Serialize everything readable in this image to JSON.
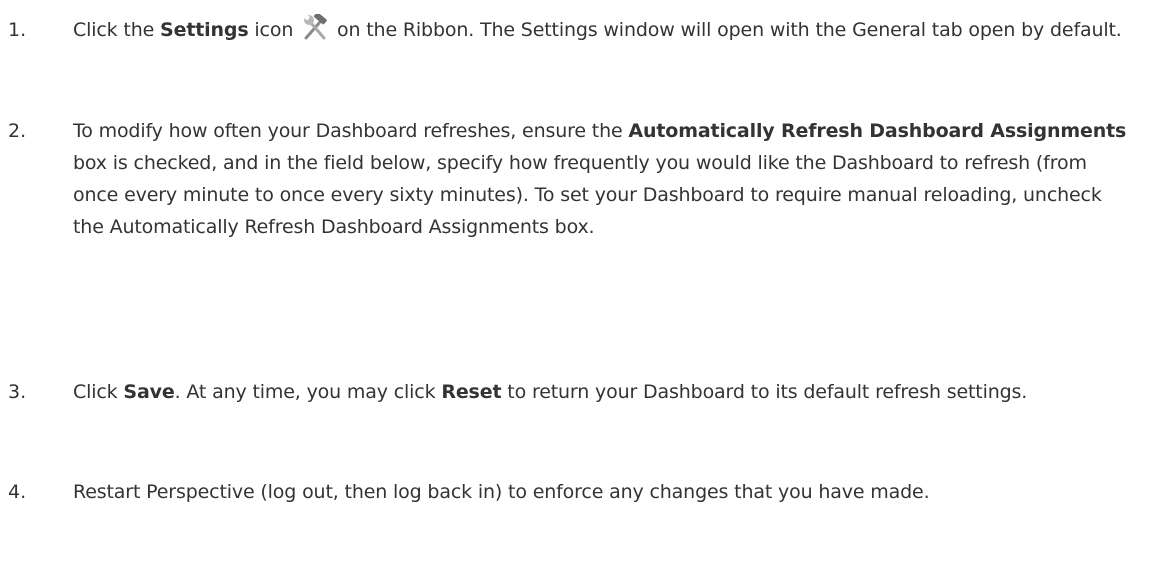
{
  "steps": [
    {
      "number": "1.",
      "segments": {
        "a": "Click the ",
        "b": "Settings",
        "c": " icon ",
        "d": " on the Ribbon. The Settings window will open with the General tab open by default."
      },
      "icon": "settings-tools-icon"
    },
    {
      "number": "2.",
      "segments": {
        "a": "To modify how often your Dashboard refreshes, ensure the ",
        "b": "Automatically Refresh Dashboard Assignments",
        "c": " box is checked, and in the field below, specify how frequently you would like the Dashboard to refresh (from once every minute to once every sixty minutes). To set your Dashboard to require manual reloading, uncheck the Automatically Refresh Dashboard Assignments box."
      }
    },
    {
      "number": "3.",
      "segments": {
        "a": "Click ",
        "b": "Save",
        "c": ". At any time, you may click ",
        "d": "Reset",
        "e": " to return your Dashboard to its default refresh settings."
      }
    },
    {
      "number": "4.",
      "segments": {
        "a": "Restart Perspective (log out, then log back in) to enforce any changes that you have made."
      }
    }
  ]
}
